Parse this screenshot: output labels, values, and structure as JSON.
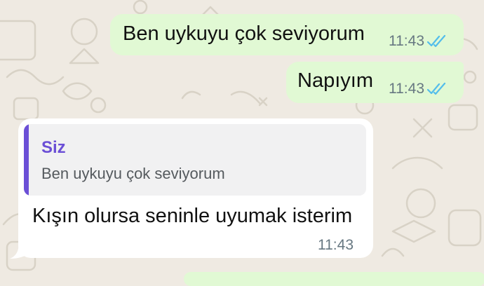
{
  "chat": {
    "messages": [
      {
        "direction": "outgoing",
        "text": "Ben uykuyu çok seviyorum",
        "time": "11:43",
        "status": "read",
        "status_icon": "double-check-icon",
        "status_color": "#53bdeb"
      },
      {
        "direction": "outgoing",
        "text": "Napıyım",
        "time": "11:43",
        "status": "read",
        "status_icon": "double-check-icon",
        "status_color": "#53bdeb"
      },
      {
        "direction": "incoming",
        "reply": {
          "author": "Siz",
          "text": "Ben uykuyu çok seviyorum",
          "accent_color": "#6b4fd6"
        },
        "text": "Kışın olursa seninle uyumak isterim",
        "time": "11:43"
      }
    ]
  },
  "theme": {
    "background": "#efeae2",
    "outgoing_bubble": "#e1f9d4",
    "incoming_bubble": "#ffffff",
    "meta_text": "#667781"
  }
}
